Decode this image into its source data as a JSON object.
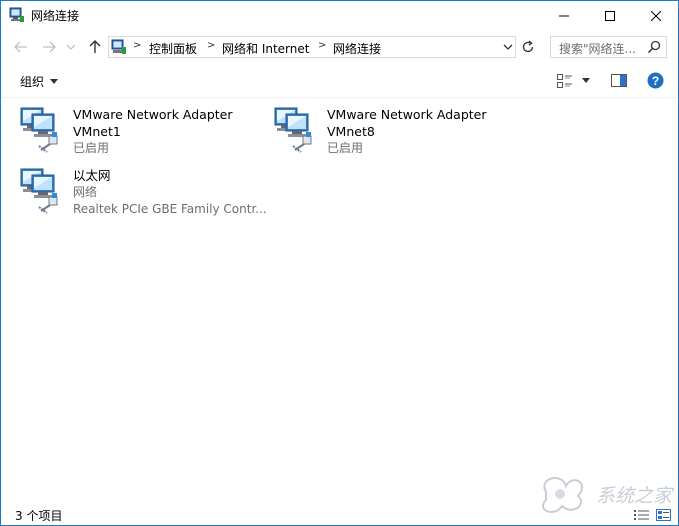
{
  "window": {
    "title": "网络连接",
    "border_color": "#1979ca"
  },
  "navigation": {
    "back_icon": "arrow-left-icon",
    "forward_icon": "arrow-right-icon",
    "recent_icon": "chevron-down-icon",
    "up_icon": "arrow-up-icon"
  },
  "address": {
    "crumbs": [
      "控制面板",
      "网络和 Internet",
      "网络连接"
    ],
    "separator": ">"
  },
  "search": {
    "placeholder": "搜索\"网络连..."
  },
  "toolbar": {
    "organize_label": "组织"
  },
  "connections": [
    {
      "name": "VMware Network Adapter",
      "device": "VMnet1",
      "status": "已启用"
    },
    {
      "name": "VMware Network Adapter",
      "device": "VMnet8",
      "status": "已启用"
    },
    {
      "name": "以太网",
      "device": "网络",
      "status": "Realtek PCIe GBE Family Contr..."
    }
  ],
  "statusbar": {
    "count": "3 个项目"
  },
  "colors": {
    "accent": "#1979ca",
    "help": "#1e6fc3",
    "muted_text": "#6d6d6d"
  }
}
